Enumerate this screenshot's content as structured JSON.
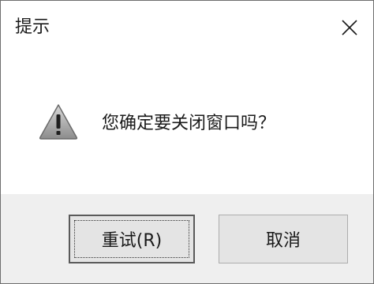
{
  "dialog": {
    "title": "提示",
    "message": "您确定要关闭窗口吗？",
    "icon": "warning-icon"
  },
  "buttons": {
    "retry_label": "重试(R)",
    "cancel_label": "取消"
  },
  "icons": {
    "close": "close-icon"
  }
}
